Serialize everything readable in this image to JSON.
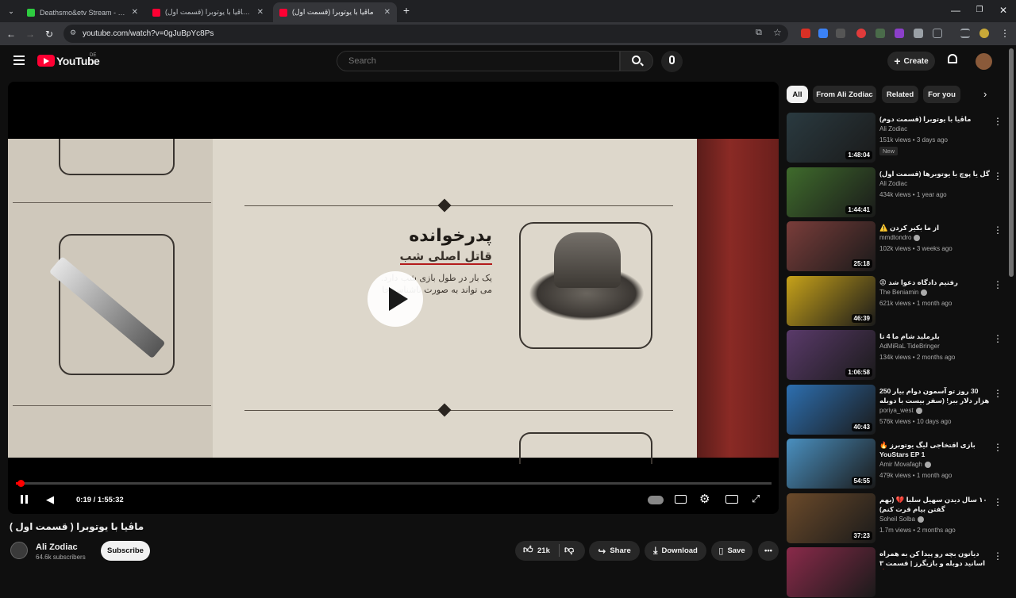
{
  "browser": {
    "tabs": [
      {
        "title": "Deathsmo&etv Stream - Watch",
        "active": false,
        "color": "#2ecc40"
      },
      {
        "title": "ماڤیا با یوتوبرا (قسمت اول) - be",
        "active": false,
        "color": "#ff0033"
      },
      {
        "title": "ماڤیا با یوتوبرا (قسمت اول)",
        "active": true,
        "color": "#ff0033"
      }
    ],
    "new_tab": "+",
    "url": "youtube.com/watch?v=0gJuBpYc8Ps"
  },
  "header": {
    "logo_text": "YouTube",
    "region": "DE",
    "search_placeholder": "Search",
    "create_label": "Create"
  },
  "player": {
    "time": "0:19 / 1:55:32",
    "progress": 0.0027,
    "artwork": {
      "heading": "پدرخوانده",
      "subheading": "قاتل اصلی شب",
      "line1": "یک بار در طول بازی شب دارد.",
      "line2": "می تواند به صورت ناشناس جا"
    }
  },
  "video": {
    "title": "ماڤیا با یوتوبرا ( قسمت اول )",
    "channel": "Ali Zodiac",
    "subscribers": "64.6k subscribers",
    "subscribe_label": "Subscribe",
    "likes": "21k",
    "share_label": "Share",
    "download_label": "Download",
    "save_label": "Save"
  },
  "sidebar": {
    "chips": [
      "All",
      "From Ali Zodiac",
      "Related",
      "For you"
    ],
    "recommendations": [
      {
        "title": "ماڤیا با یوتوبرا (قسمت دوم)",
        "channel": "Ali Zodiac",
        "verified": false,
        "meta": "151k views • 3 days ago",
        "duration": "1:48:04",
        "badge": "New",
        "thumb_color": "#2a3a40"
      },
      {
        "title": "گل یا پوچ با یوتوبرها (قسمت اول)",
        "channel": "Ali Zodiac",
        "verified": false,
        "meta": "434k views • 1 year ago",
        "duration": "1:44:41",
        "badge": "",
        "thumb_color": "#3f6b2c"
      },
      {
        "title": "از ما بکیر کردن ⚠️",
        "channel": "mmdtondro",
        "verified": true,
        "meta": "102k views • 3 weeks ago",
        "duration": "25:18",
        "badge": "",
        "thumb_color": "#7a3d3a"
      },
      {
        "title": "رفتیم دادگاه دعوا شد 😡",
        "channel": "The Beniamin",
        "verified": true,
        "meta": "621k views • 1 month ago",
        "duration": "46:39",
        "badge": "",
        "thumb_color": "#c7a21a"
      },
      {
        "title": "بلرملید شام ما 4 تا",
        "channel": "AdMiRaL TideBringer",
        "verified": false,
        "meta": "134k views • 2 months ago",
        "duration": "1:06:58",
        "badge": "",
        "thumb_color": "#5a3a6a"
      },
      {
        "title": "30 روز تو آسمون دوام بیار 250 هزار دلار ببر! (سفر بیست با دوبله فارسی)",
        "channel": "poriya_west",
        "verified": true,
        "meta": "576k views • 10 days ago",
        "duration": "40:43",
        "badge": "",
        "thumb_color": "#2d6fb0"
      },
      {
        "title": "بازی اقتخاجی لیگ یوتوبرز 🔥 YouStars EP 1",
        "channel": "Amir Movafagh",
        "verified": true,
        "meta": "479k views • 1 month ago",
        "duration": "54:55",
        "badge": "",
        "thumb_color": "#4a90c0"
      },
      {
        "title": "۱۰ سال دیدن سهیل سلبا 💔 (بهم گفتن بیام قرت کنم)",
        "channel": "Soheil Solba",
        "verified": true,
        "meta": "1.7m views • 2 months ago",
        "duration": "37:23",
        "badge": "",
        "thumb_color": "#6b4a2a"
      },
      {
        "title": "دیاتون بچه رو پیدا کن به همراه اسانید دوبله و بازیگرز | قسمت ۳ 🔥",
        "channel": "",
        "verified": false,
        "meta": "",
        "duration": "",
        "badge": "",
        "thumb_color": "#8a2a4a"
      }
    ]
  }
}
